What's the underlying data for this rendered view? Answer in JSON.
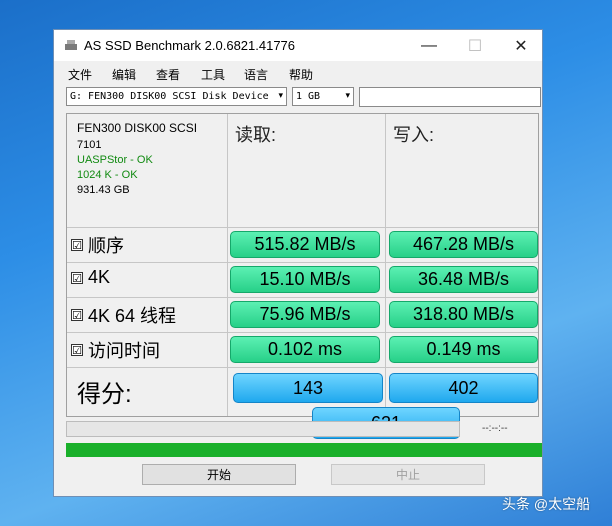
{
  "window": {
    "title": "AS SSD Benchmark 2.0.6821.41776"
  },
  "controls": {
    "minimize": "—",
    "maximize": "☐",
    "close": "✕"
  },
  "menu": [
    "文件",
    "编辑",
    "查看",
    "工具",
    "语言",
    "帮助"
  ],
  "toolbar": {
    "drive": "G: FEN300 DISK00 SCSI Disk Device",
    "size": "1 GB",
    "arrow": "▾"
  },
  "info": {
    "model": "FEN300 DISK00 SCSI",
    "firmware": "7101",
    "driver": "UASPStor - OK",
    "alignment": "1024 K - OK",
    "capacity": "931.43 GB"
  },
  "headers": {
    "read": "读取:",
    "write": "写入:"
  },
  "checkmark": "☑",
  "rows": [
    {
      "label": "顺序",
      "read": "515.82 MB/s",
      "write": "467.28 MB/s"
    },
    {
      "label": "4K",
      "read": "15.10 MB/s",
      "write": "36.48 MB/s"
    },
    {
      "label": "4K 64 线程",
      "read": "75.96 MB/s",
      "write": "318.80 MB/s"
    },
    {
      "label": "访问时间",
      "read": "0.102 ms",
      "write": "0.149 ms"
    }
  ],
  "score": {
    "label": "得分:",
    "read": "143",
    "write": "402",
    "total": "621"
  },
  "status": {
    "time": "--:--:--"
  },
  "buttons": {
    "start": "开始",
    "abort": "中止"
  },
  "colors": {
    "result_green": "#27d088",
    "score_blue": "#1fa8ee",
    "progress_green": "#1ab02a"
  },
  "watermark": "头条 @太空船"
}
